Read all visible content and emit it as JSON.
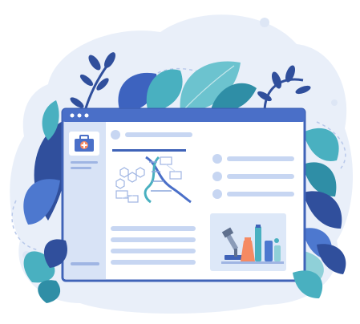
{
  "palette": {
    "blob": "#e9eff9",
    "blob_dark": "#dde6f5",
    "frame": "#3f63b8",
    "titlebar": "#4a6fc8",
    "window_bg": "#ffffff",
    "sidebar": "#d8e3f6",
    "placeholder": "#c7d6f2",
    "leaf_dark": "#304f9c",
    "leaf_mid": "#4d78cf",
    "leaf_teal": "#49b0c0",
    "leaf_teal_dark": "#2f8ea6",
    "leaf_light": "#8fd0d8",
    "accent_orange": "#f58a63"
  },
  "icons": {
    "window_dots": [
      "dot-icon",
      "dot-icon",
      "dot-icon"
    ],
    "sidebar_logo": "medical-kit-icon",
    "illustration_main": "dna-molecule-illustration",
    "illustration_side": "lab-equipment-illustration"
  }
}
